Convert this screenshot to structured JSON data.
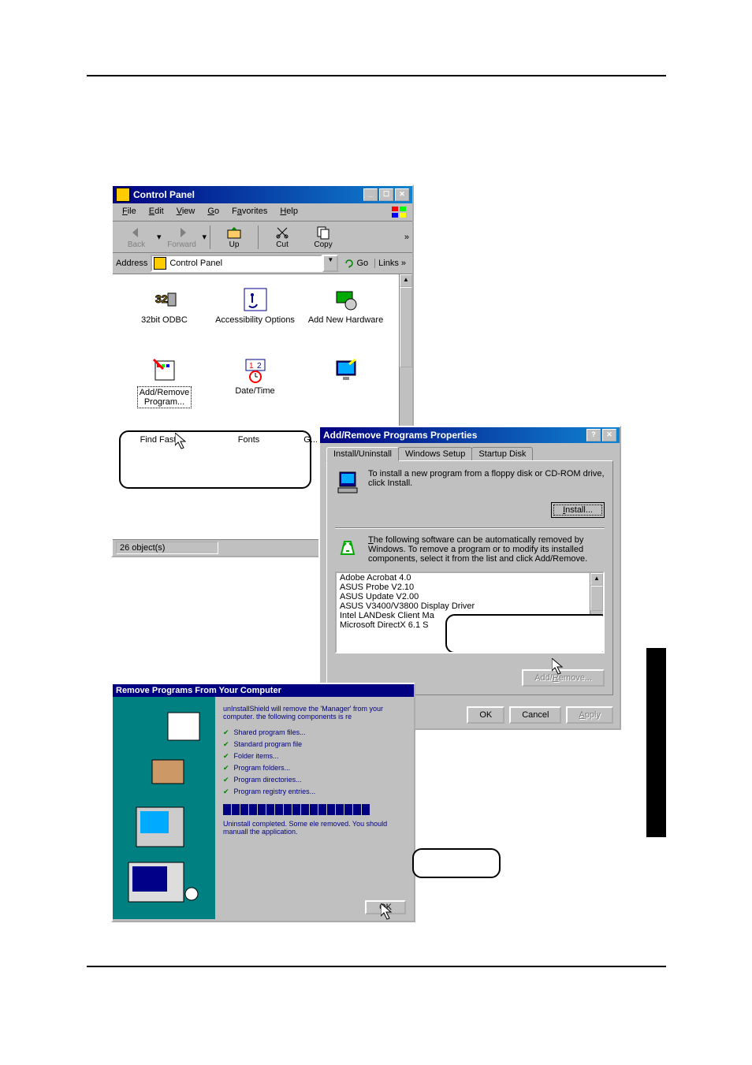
{
  "cp": {
    "title": "Control Panel",
    "menu": {
      "file": "File",
      "edit": "Edit",
      "view": "View",
      "go": "Go",
      "favorites": "Favorites",
      "help": "Help"
    },
    "toolbar": {
      "back": "Back",
      "forward": "Forward",
      "up": "Up",
      "cut": "Cut",
      "copy": "Copy",
      "more": "»"
    },
    "address": {
      "label": "Address",
      "value": "Control Panel",
      "go": "Go",
      "links": "Links »"
    },
    "icons": [
      {
        "label": "32bit ODBC"
      },
      {
        "label": "Accessibility Options"
      },
      {
        "label": "Add New Hardware"
      },
      {
        "label": "Add/Remove Programs",
        "selected": true
      },
      {
        "label": "Date/Time"
      },
      {
        "label": ""
      },
      {
        "label": "Find Fast"
      },
      {
        "label": "Fonts"
      },
      {
        "label": "G..."
      }
    ],
    "status": "26 object(s)"
  },
  "arp": {
    "title": "Add/Remove Programs Properties",
    "tabs": {
      "install": "Install/Uninstall",
      "setup": "Windows Setup",
      "startup": "Startup Disk"
    },
    "install_text": "To install a new program from a floppy disk or CD-ROM drive, click Install.",
    "install_btn": "Install...",
    "remove_text": "The following software can be automatically removed by Windows. To remove a program or to modify its installed components, select it from the list and click Add/Remove.",
    "programs": [
      "Adobe Acrobat 4.0",
      "ASUS Probe V2.10",
      "ASUS Update V2.00",
      "ASUS V3400/V3800 Display Driver",
      "Intel LANDesk Client Ma",
      "Microsoft DirectX 6.1 S"
    ],
    "addremove_btn": "Add/Remove...",
    "ok": "OK",
    "cancel": "Cancel",
    "apply": "Apply"
  },
  "unin": {
    "title": "Remove Programs From Your Computer",
    "desc": "unInstallShield will remove the 'Manager' from your computer. the following components is re",
    "items": [
      "Shared program files...",
      "Standard program file",
      "Folder items...",
      "Program folders...",
      "Program directories...",
      "Program registry entries..."
    ],
    "done": "Uninstall completed. Some ele removed. You should manuall the application.",
    "ok": "OK"
  }
}
